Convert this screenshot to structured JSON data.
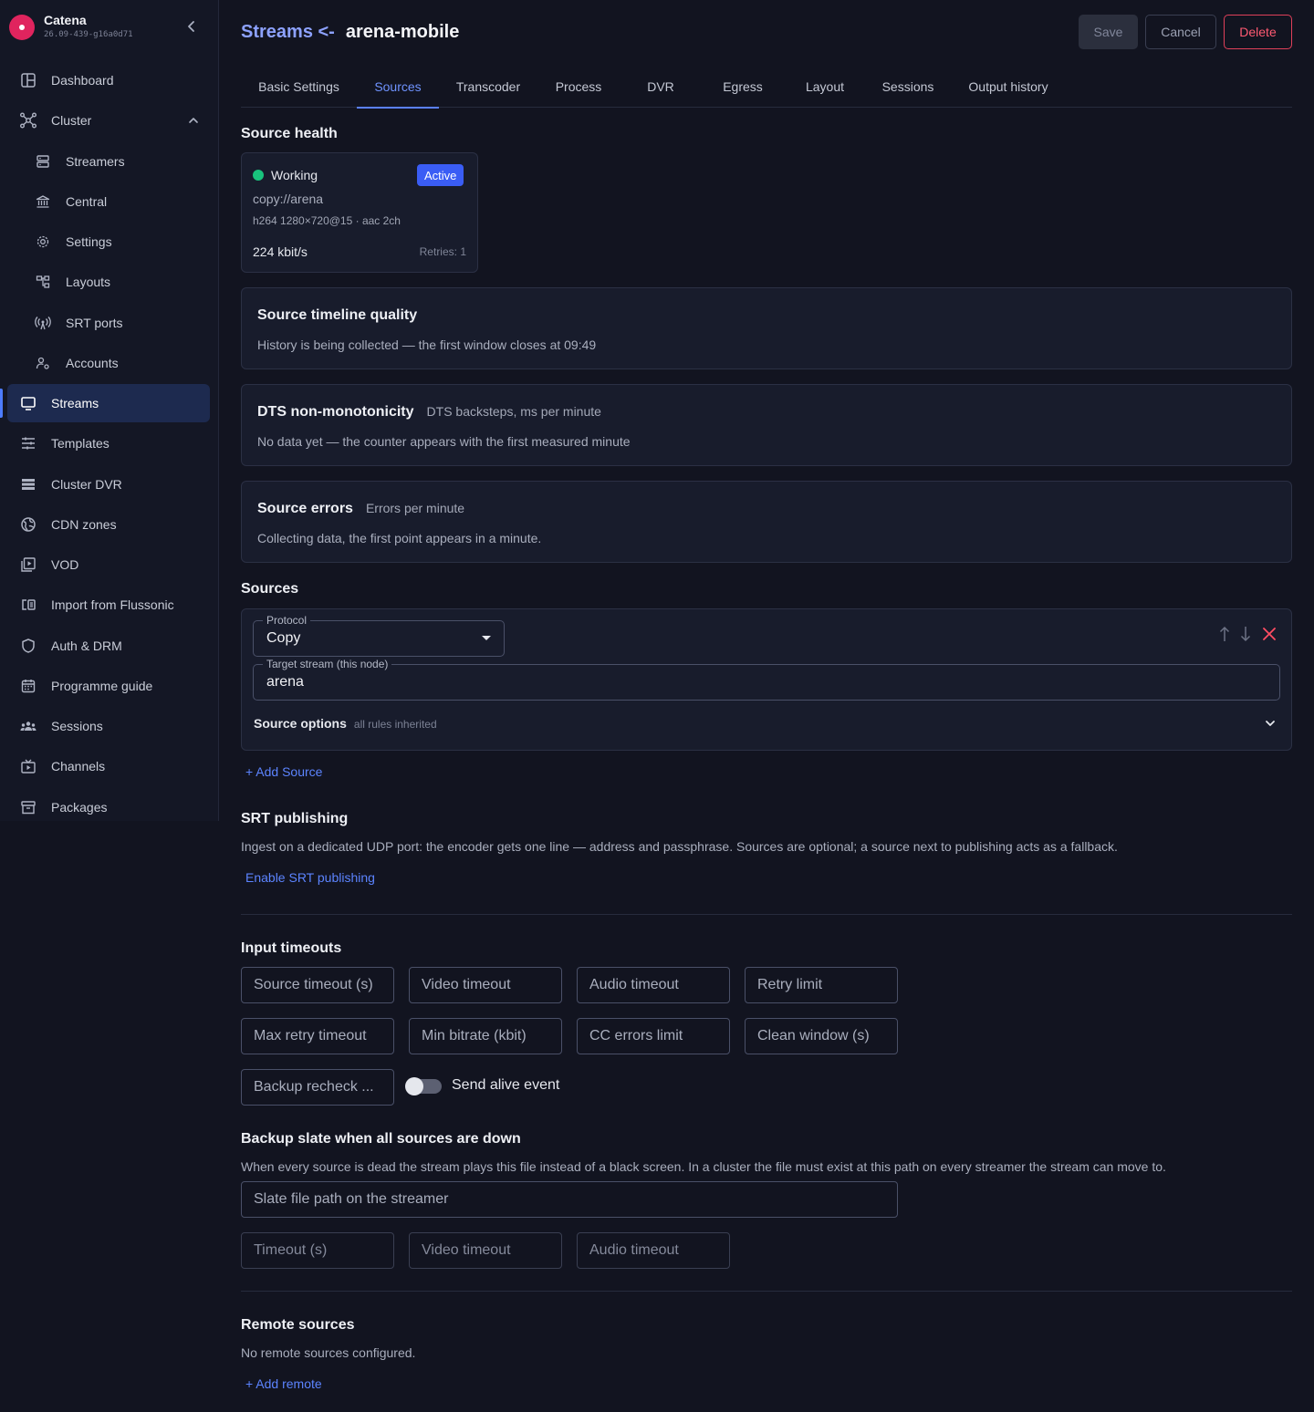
{
  "app": {
    "name": "Catena",
    "version": "26.09-439-g16a0d71"
  },
  "sidebar": {
    "items": [
      {
        "label": "Dashboard"
      },
      {
        "label": "Cluster"
      },
      {
        "label": "Streamers"
      },
      {
        "label": "Central"
      },
      {
        "label": "Settings"
      },
      {
        "label": "Layouts"
      },
      {
        "label": "SRT ports"
      },
      {
        "label": "Accounts"
      },
      {
        "label": "Streams"
      },
      {
        "label": "Templates"
      },
      {
        "label": "Cluster DVR"
      },
      {
        "label": "CDN zones"
      },
      {
        "label": "VOD"
      },
      {
        "label": "Import from Flussonic"
      },
      {
        "label": "Auth & DRM"
      },
      {
        "label": "Programme guide"
      },
      {
        "label": "Sessions"
      },
      {
        "label": "Channels"
      },
      {
        "label": "Packages"
      }
    ]
  },
  "header": {
    "breadcrumb": "Streams <-",
    "title": "arena-mobile",
    "save": "Save",
    "cancel": "Cancel",
    "delete": "Delete"
  },
  "tabs": [
    "Basic Settings",
    "Sources",
    "Transcoder",
    "Process",
    "DVR",
    "Egress",
    "Layout",
    "Sessions",
    "Output history"
  ],
  "source_health": {
    "title": "Source health",
    "state": "Working",
    "badge": "Active",
    "url": "copy://arena",
    "codec": "h264 1280×720@15 · aac 2ch",
    "bitrate": "224 kbit/s",
    "retries": "Retries: 1",
    "status_color": "#19c37d"
  },
  "panels": {
    "timeline": {
      "title": "Source timeline quality",
      "text": "History is being collected — the first window closes at 09:49"
    },
    "dts": {
      "title": "DTS non-monotonicity",
      "subtitle": "DTS backsteps, ms per minute",
      "text": "No data yet — the counter appears with the first measured minute"
    },
    "errors": {
      "title": "Source errors",
      "subtitle": "Errors per minute",
      "text": "Collecting data, the first point appears in a minute."
    }
  },
  "sources": {
    "title": "Sources",
    "protocol_label": "Protocol",
    "protocol_value": "Copy",
    "target_label": "Target stream (this node)",
    "target_value": "arena",
    "options_label": "Source options",
    "options_sub": "all rules inherited",
    "add": "+ Add Source"
  },
  "srt": {
    "title": "SRT publishing",
    "text": "Ingest on a dedicated UDP port: the encoder gets one line — address and passphrase. Sources are optional; a source next to publishing acts as a fallback.",
    "enable": "Enable SRT publishing"
  },
  "timeouts": {
    "title": "Input timeouts",
    "fields": [
      "Source timeout (s)",
      "Video timeout",
      "Audio timeout",
      "Retry limit",
      "Max retry timeout",
      "Min bitrate (kbit)",
      "CC errors limit",
      "Clean window (s)",
      "Backup recheck ..."
    ],
    "alive_label": "Send alive event"
  },
  "slate": {
    "title": "Backup slate when all sources are down",
    "text": "When every source is dead the stream plays this file instead of a black screen. In a cluster the file must exist at this path on every streamer the stream can move to.",
    "path_placeholder": "Slate file path on the streamer",
    "fields": [
      "Timeout (s)",
      "Video timeout",
      "Audio timeout"
    ]
  },
  "remote": {
    "title": "Remote sources",
    "text": "No remote sources configured.",
    "add": "+ Add remote"
  },
  "colors": {
    "accent": "#5c84ff",
    "danger": "#ff5a72",
    "background": "#121420",
    "active_nav": "#1d2a4f"
  }
}
